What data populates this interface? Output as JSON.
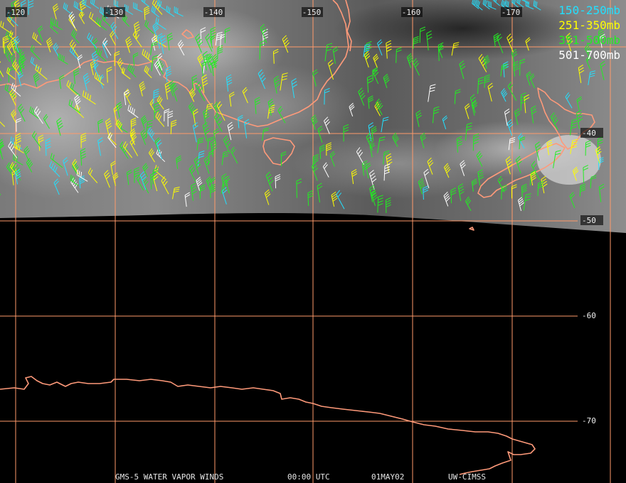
{
  "legend": [
    {
      "label": "150-250mb",
      "color": "#22e0ff"
    },
    {
      "label": "251-350mb",
      "color": "#ffff00"
    },
    {
      "label": "351-500mb",
      "color": "#22ee22"
    },
    {
      "label": "501-700mb",
      "color": "#ffffff"
    }
  ],
  "longitude_ticks": [
    "-120",
    "-130",
    "-140",
    "-150",
    "-160",
    "-170"
  ],
  "latitude_ticks": [
    "-40",
    "-50",
    "-60",
    "-70"
  ],
  "footer": {
    "product": "GMS-5 WATER VAPOR WINDS",
    "time": "00:00 UTC",
    "date": "01MAY02",
    "source": "UW-CIMSS"
  },
  "colors": {
    "gridline": "#ff9a6a",
    "coastline": "#ff9a7a",
    "background": "#000000"
  }
}
